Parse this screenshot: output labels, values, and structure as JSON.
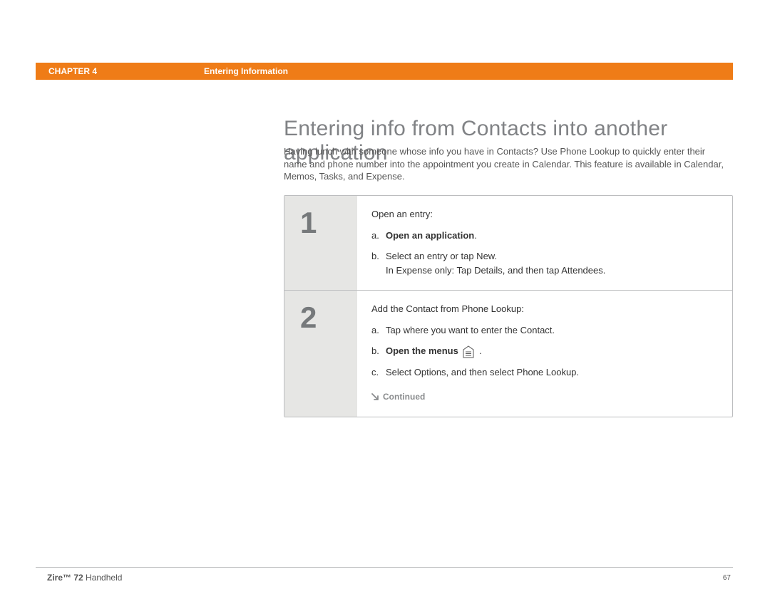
{
  "header": {
    "chapter": "CHAPTER 4",
    "section": "Entering Information"
  },
  "title": "Entering info from Contacts into another application",
  "intro": "Having lunch with someone whose info you have in Contacts? Use Phone Lookup to quickly enter their name and phone number into the appointment you create in Calendar. This feature is available in Calendar, Memos, Tasks, and Expense.",
  "steps": [
    {
      "number": "1",
      "lead": "Open an entry:",
      "items": [
        {
          "label": "a.",
          "prefix": "",
          "link": "Open an application",
          "suffix": "."
        },
        {
          "label": "b.",
          "text": "Select an entry or tap New.",
          "note": "In Expense only: Tap Details, and then tap Attendees."
        }
      ]
    },
    {
      "number": "2",
      "lead": "Add the Contact from Phone Lookup:",
      "items": [
        {
          "label": "a.",
          "text": "Tap where you want to enter the Contact."
        },
        {
          "label": "b.",
          "link": "Open the menus",
          "icon": "menus-icon",
          "suffix": " ."
        },
        {
          "label": "c.",
          "text": "Select Options, and then select Phone Lookup."
        }
      ],
      "continued": "Continued"
    }
  ],
  "footer": {
    "product_bold": "Zire™ 72",
    "product_rest": " Handheld",
    "page": "67"
  }
}
